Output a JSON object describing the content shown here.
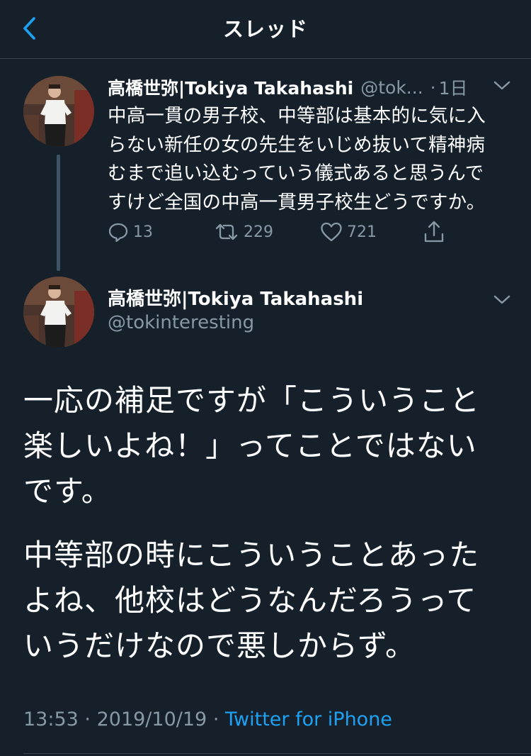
{
  "header": {
    "title": "スレッド",
    "back_icon": "chevron-left-icon"
  },
  "colors": {
    "background": "#15202b",
    "accent": "#1da1f2",
    "secondary_text": "#8899a6",
    "divider": "#38444d"
  },
  "parent_tweet": {
    "display_name": "高橋世弥|Tokiya Takahashi",
    "handle": "@tok...",
    "separator": "·",
    "time_ago": "1日",
    "text": "中高一貫の男子校、中等部は基本的に気に入\nらない新任の女の先生をいじめ抜いて精神病\nむまで追い込むっていう儀式あると思うんで\nすけど全国の中高一貫男子校生どうですか。",
    "actions": {
      "reply_count": "13",
      "retweet_count": "229",
      "like_count": "721"
    }
  },
  "main_tweet": {
    "display_name": "高橋世弥|Tokiya Takahashi",
    "handle": "@tokinteresting",
    "paragraphs": [
      "一応の補足ですが「こういうこと\n楽しいよね！」ってことではない\nです。",
      "中等部の時にこういうことあった\nよね、他校はどうなんだろうって\nいうだけなので悪しからず。"
    ],
    "time": "13:53",
    "date": "2019/10/19",
    "separator": "·",
    "source": "Twitter for iPhone"
  }
}
